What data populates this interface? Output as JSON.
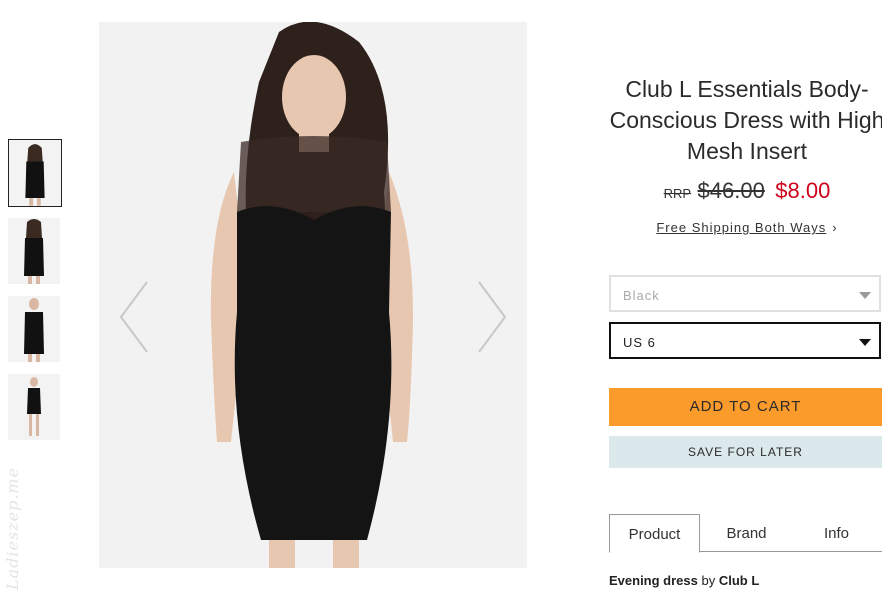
{
  "product": {
    "title": "Club L Essentials Body-Conscious Dress with High Mesh Insert",
    "rrp_label": "RRP",
    "old_price": "$46.00",
    "new_price": "$8.00",
    "shipping": {
      "label": "Free Shipping Both Ways",
      "chevron": "›"
    },
    "color_select": {
      "value": "Black",
      "icon": "caret-down-icon"
    },
    "size_select": {
      "value": "US 6",
      "icon": "caret-down-icon"
    },
    "add_to_cart": "ADD TO CART",
    "save_for_later": "SAVE FOR LATER",
    "tabs": [
      {
        "label": "Product",
        "active": true
      },
      {
        "label": "Brand",
        "active": false
      },
      {
        "label": "Info",
        "active": false
      }
    ],
    "description": {
      "type": "Evening dress",
      "by": "by",
      "brand": "Club L"
    }
  },
  "gallery": {
    "thumbnails": [
      "front-view",
      "back-view",
      "front-full",
      "full-length"
    ],
    "selected_index": 0,
    "prev_icon": "chevron-left-icon",
    "next_icon": "chevron-right-icon"
  },
  "watermark": "Ladieszep.me",
  "colors": {
    "price_sale": "#d0021b",
    "cart_button": "#fa9b2b",
    "save_button": "#dbe8ec"
  }
}
